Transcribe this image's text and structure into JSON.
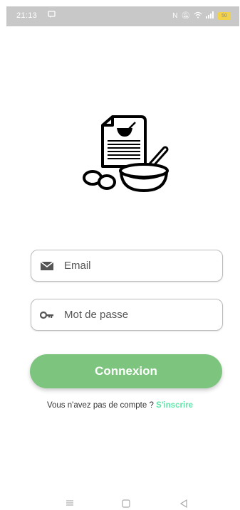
{
  "status_bar": {
    "time": "21:13",
    "battery": "50"
  },
  "logo": {
    "icon": "recipe-bowl-logo-icon"
  },
  "login_form": {
    "email_placeholder": "Email",
    "email_value": "",
    "email_icon": "envelope-icon",
    "password_placeholder": "Mot de passe",
    "password_value": "",
    "password_icon": "key-icon",
    "submit_label": "Connexion"
  },
  "signup": {
    "prompt": "Vous n'avez pas de compte ?",
    "link_label": "S'inscrire",
    "link_color": "#5ee6a8"
  },
  "colors": {
    "primary_button": "#7dc57f",
    "status_bar": "#c8c8c8"
  },
  "nav_bar": {
    "items": [
      "menu-icon",
      "home-icon",
      "back-icon"
    ]
  }
}
